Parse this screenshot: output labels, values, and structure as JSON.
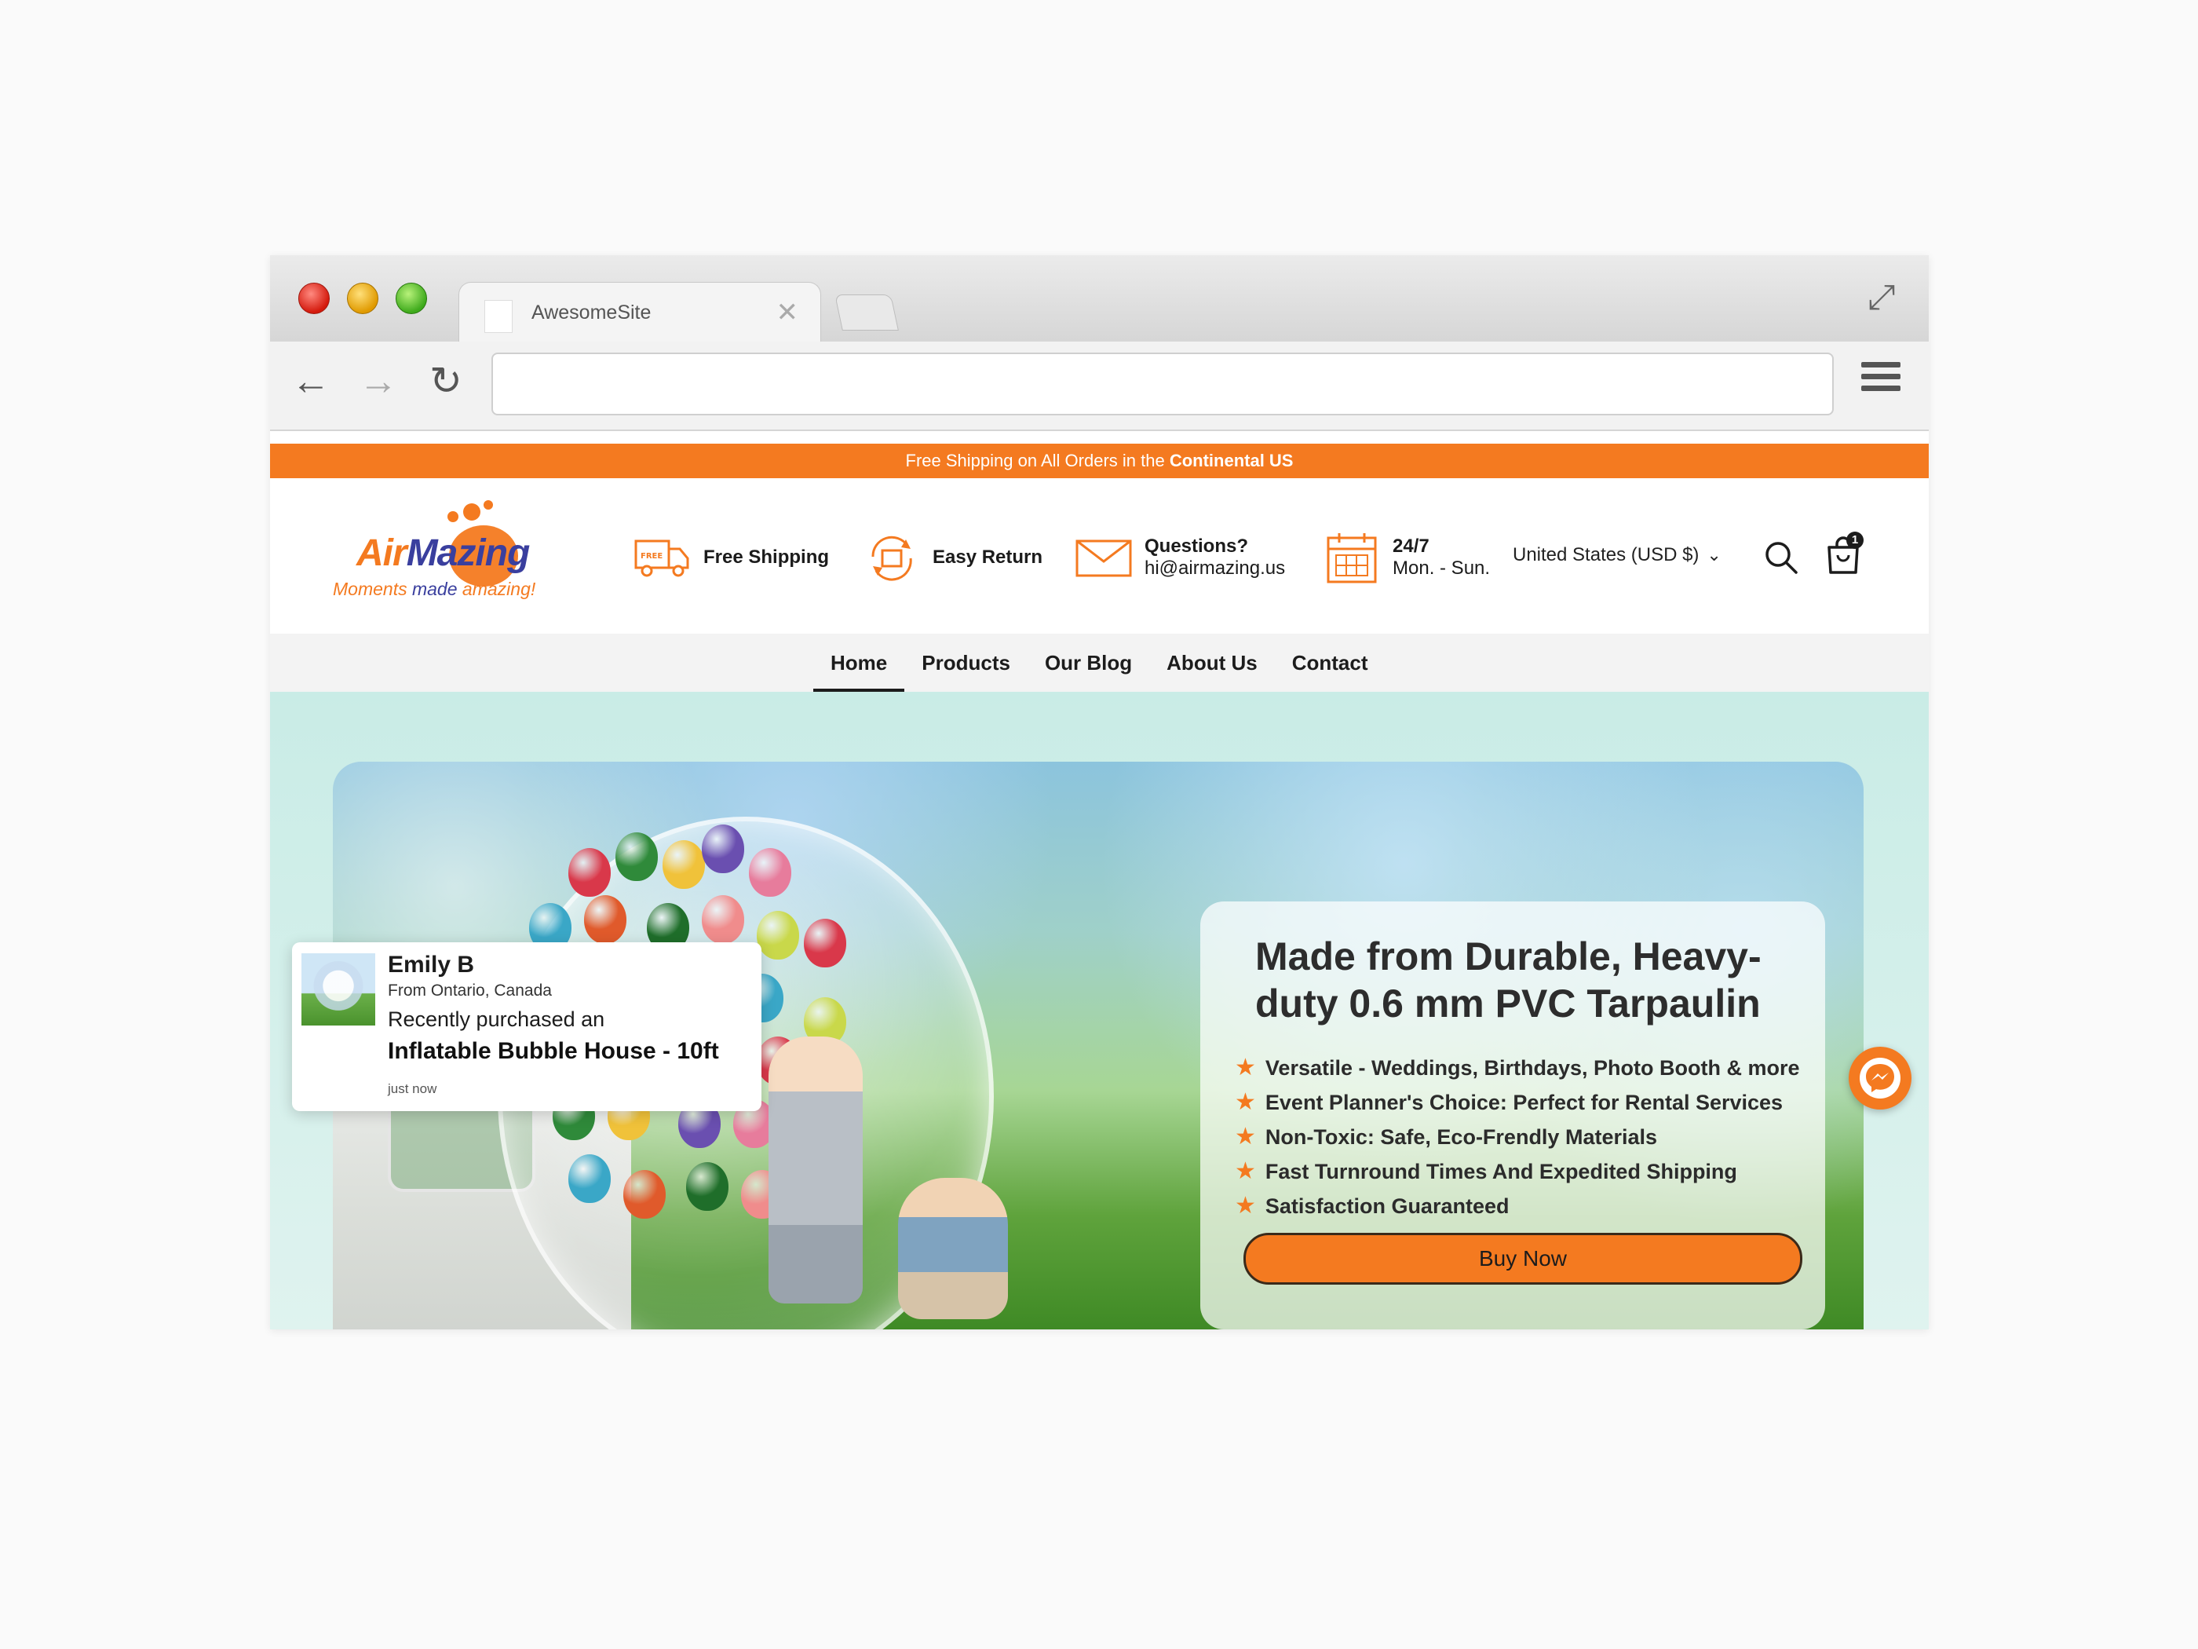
{
  "browser": {
    "tab_title": "AwesomeSite",
    "tab_close_icon": "close-icon",
    "url": ""
  },
  "announcement": {
    "text": "Free Shipping on All Orders in the ",
    "bold": "Continental US"
  },
  "logo": {
    "brand_part1": "Air",
    "brand_part2": "Mazing",
    "tagline_part1": "Moments ",
    "tagline_made": "made",
    "tagline_part2": " amazing!"
  },
  "features": [
    {
      "icon": "truck-icon",
      "line1": "Free Shipping",
      "line2": ""
    },
    {
      "icon": "return-box-icon",
      "line1": "Easy Return",
      "line2": ""
    },
    {
      "icon": "envelope-icon",
      "line1": "Questions?",
      "line2": "hi@airmazing.us"
    },
    {
      "icon": "calendar-icon",
      "line1": "24/7",
      "line2": "Mon. - Sun."
    }
  ],
  "header": {
    "country": "United States (USD $)",
    "cart_count": "1"
  },
  "nav": {
    "items": [
      "Home",
      "Products",
      "Our Blog",
      "About Us",
      "Contact"
    ],
    "active": "Home"
  },
  "hero": {
    "headline": "Made from Durable, Heavy-duty 0.6 mm PVC Tarpaulin",
    "bullets": [
      "Versatile - Weddings, Birthdays, Photo Booth & more",
      "Event Planner's Choice: Perfect for Rental Services",
      "Non-Toxic: Safe, Eco-Frendly Materials",
      "Fast Turnround Times And Expedited Shipping",
      "Satisfaction Guaranteed"
    ],
    "cta": "Buy Now"
  },
  "toast": {
    "name": "Emily B",
    "from": "From Ontario, Canada",
    "recent": "Recently purchased an",
    "product": "Inflatable Bubble House - 10ft",
    "time": "just now"
  },
  "colors": {
    "accent": "#f47a20",
    "brand_blue": "#3a3f9e",
    "nav_bg": "#f3f3f3",
    "hero_bg": "#c9ece6"
  }
}
